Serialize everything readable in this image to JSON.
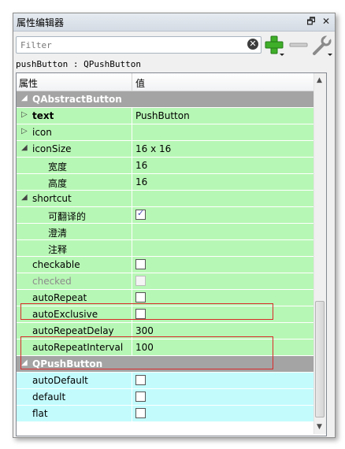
{
  "window": {
    "title": "属性编辑器",
    "float_glyph": "🗗",
    "close_glyph": "✕"
  },
  "toolbar": {
    "filter_placeholder": "Filter",
    "clear_glyph": "✕",
    "add_icon": "green-plus-icon",
    "remove_icon": "minus-icon",
    "config_icon": "wrench-icon"
  },
  "object_info": "pushButton : QPushButton",
  "header": {
    "property": "属性",
    "value": "值"
  },
  "rows": [
    {
      "type": "group",
      "label": "QAbstractButton",
      "expanded": true
    },
    {
      "type": "prop",
      "label": "text",
      "value": "PushButton",
      "bold": true,
      "expandable": true,
      "expanded": false,
      "color": "green"
    },
    {
      "type": "prop",
      "label": "icon",
      "value": "",
      "expandable": true,
      "expanded": false,
      "color": "green"
    },
    {
      "type": "prop",
      "label": "iconSize",
      "value": "16 x 16",
      "expandable": true,
      "expanded": true,
      "color": "green"
    },
    {
      "type": "sub",
      "label": "宽度",
      "value": "16",
      "color": "green"
    },
    {
      "type": "sub",
      "label": "高度",
      "value": "16",
      "color": "green"
    },
    {
      "type": "prop",
      "label": "shortcut",
      "value": "",
      "expandable": true,
      "expanded": true,
      "color": "green"
    },
    {
      "type": "sub",
      "label": "可翻译的",
      "checkbox": true,
      "checked": true,
      "color": "green"
    },
    {
      "type": "sub",
      "label": "澄清",
      "value": "",
      "color": "green"
    },
    {
      "type": "sub",
      "label": "注释",
      "value": "",
      "color": "green"
    },
    {
      "type": "prop",
      "label": "checkable",
      "checkbox": true,
      "checked": false,
      "color": "green"
    },
    {
      "type": "prop",
      "label": "checked",
      "checkbox": true,
      "checked": false,
      "disabled": true,
      "color": "green"
    },
    {
      "type": "prop",
      "label": "autoRepeat",
      "checkbox": true,
      "checked": false,
      "color": "green"
    },
    {
      "type": "prop",
      "label": "autoExclusive",
      "checkbox": true,
      "checked": false,
      "color": "green"
    },
    {
      "type": "prop",
      "label": "autoRepeatDelay",
      "value": "300",
      "color": "green"
    },
    {
      "type": "prop",
      "label": "autoRepeatInterval",
      "value": "100",
      "color": "green"
    },
    {
      "type": "group",
      "label": "QPushButton",
      "expanded": true
    },
    {
      "type": "prop",
      "label": "autoDefault",
      "checkbox": true,
      "checked": false,
      "color": "cyan"
    },
    {
      "type": "prop",
      "label": "default",
      "checkbox": true,
      "checked": false,
      "color": "cyan"
    },
    {
      "type": "prop",
      "label": "flat",
      "checkbox": true,
      "checked": false,
      "color": "cyan"
    }
  ],
  "scrollbar": {
    "up_glyph": "▲",
    "down_glyph": "▼"
  }
}
